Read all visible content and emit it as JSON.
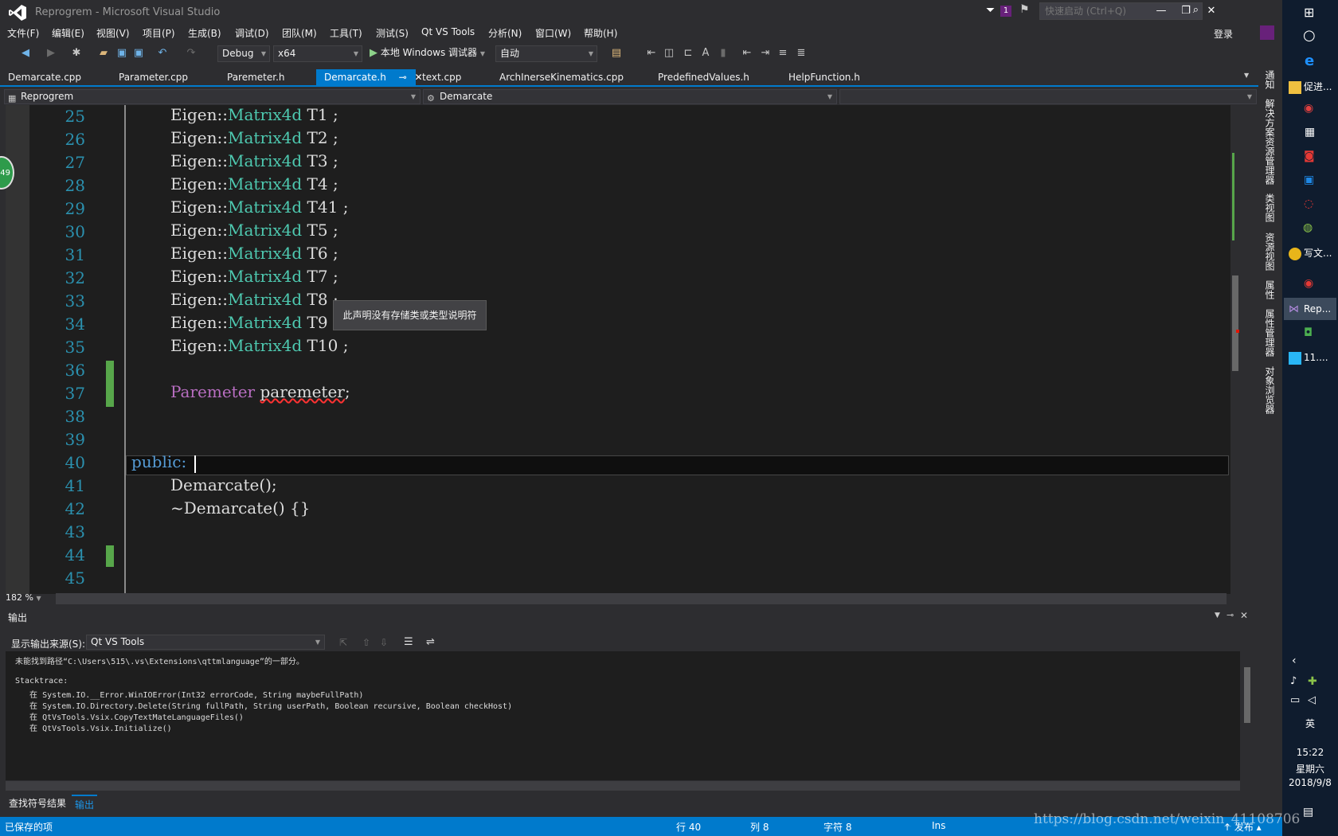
{
  "window": {
    "title": "Reprogrem - Microsoft Visual Studio",
    "notification_count": "1",
    "quicklaunch_placeholder": "快速启动 (Ctrl+Q)",
    "login_label": "登录"
  },
  "menu": [
    "文件(F)",
    "编辑(E)",
    "视图(V)",
    "项目(P)",
    "生成(B)",
    "调试(D)",
    "团队(M)",
    "工具(T)",
    "测试(S)",
    "Qt VS Tools",
    "分析(N)",
    "窗口(W)",
    "帮助(H)"
  ],
  "toolbar": {
    "config": "Debug",
    "platform": "x64",
    "run_label": "本地 Windows 调试器",
    "run_mode": "自动"
  },
  "tabs": [
    {
      "label": "Demarcate.cpp"
    },
    {
      "label": "Parameter.cpp"
    },
    {
      "label": "Paremeter.h"
    },
    {
      "label": "Demarcate.h"
    },
    {
      "label": "text.cpp"
    },
    {
      "label": "ArchInerseKinematics.cpp"
    },
    {
      "label": "PredefinedValues.h"
    },
    {
      "label": "HelpFunction.h"
    }
  ],
  "navbar": {
    "project": "Reprogrem",
    "scope": "Demarcate"
  },
  "editor": {
    "line_numbers": [
      "25",
      "26",
      "27",
      "28",
      "29",
      "30",
      "31",
      "32",
      "33",
      "34",
      "35",
      "36",
      "37",
      "38",
      "39",
      "40",
      "41",
      "42",
      "43",
      "44",
      "45"
    ],
    "matrix_lines": [
      {
        "ns": "Eigen::",
        "type": "Matrix4d",
        "rest": " T1 ;"
      },
      {
        "ns": "Eigen::",
        "type": "Matrix4d",
        "rest": " T2 ;"
      },
      {
        "ns": "Eigen::",
        "type": "Matrix4d",
        "rest": " T3 ;"
      },
      {
        "ns": "Eigen::",
        "type": "Matrix4d",
        "rest": " T4 ;"
      },
      {
        "ns": "Eigen::",
        "type": "Matrix4d",
        "rest": " T41 ;"
      },
      {
        "ns": "Eigen::",
        "type": "Matrix4d",
        "rest": " T5 ;"
      },
      {
        "ns": "Eigen::",
        "type": "Matrix4d",
        "rest": " T6 ;"
      },
      {
        "ns": "Eigen::",
        "type": "Matrix4d",
        "rest": " T7 ;"
      },
      {
        "ns": "Eigen::",
        "type": "Matrix4d",
        "rest": " T8 ;"
      },
      {
        "ns": "Eigen::",
        "type": "Matrix4d",
        "rest": " T9 ;"
      },
      {
        "ns": "Eigen::",
        "type": "Matrix4d",
        "rest": " T10 ;"
      }
    ],
    "member_decl": {
      "type": "Paremeter",
      "name": "paremeter",
      "end": ";"
    },
    "public_kw": "public:",
    "ctor": "Demarcate();",
    "dtor": "~Demarcate() {}",
    "tooltip": "此声明没有存储类或类型说明符",
    "zoom": "182 %",
    "left_badge": "49"
  },
  "output": {
    "title": "输出",
    "source_label": "显示输出来源(S):",
    "source": "Qt VS Tools",
    "lines": [
      "未能找到路径“C:\\Users\\515\\.vs\\Extensions\\qttmlanguage”的一部分。",
      "",
      "Stacktrace:",
      "   在 System.IO.__Error.WinIOError(Int32 errorCode, String maybeFullPath)",
      "   在 System.IO.Directory.Delete(String fullPath, String userPath, Boolean recursive, Boolean checkHost)",
      "   在 QtVsTools.Vsix.CopyTextMateLanguageFiles()",
      "   在 QtVsTools.Vsix.Initialize()"
    ]
  },
  "bottom_tabs": [
    "查找符号结果",
    "输出"
  ],
  "status": {
    "message": "已保存的项",
    "line": "行 40",
    "col": "列 8",
    "char": "字符 8",
    "mode": "Ins",
    "publish": "↑ 发布 ▴"
  },
  "right_strip": [
    "通知",
    "解决方案资源管理器",
    "类视图",
    "资源视图",
    "属性",
    "属性管理器",
    "对象浏览器"
  ],
  "taskbar": {
    "items": [
      "促进...",
      "写文...",
      "Rep...",
      "11...."
    ],
    "ime": "英",
    "time": "15:22",
    "weekday": "星期六",
    "date": "2018/9/8"
  },
  "watermark": "https://blog.csdn.net/weixin_41108706"
}
